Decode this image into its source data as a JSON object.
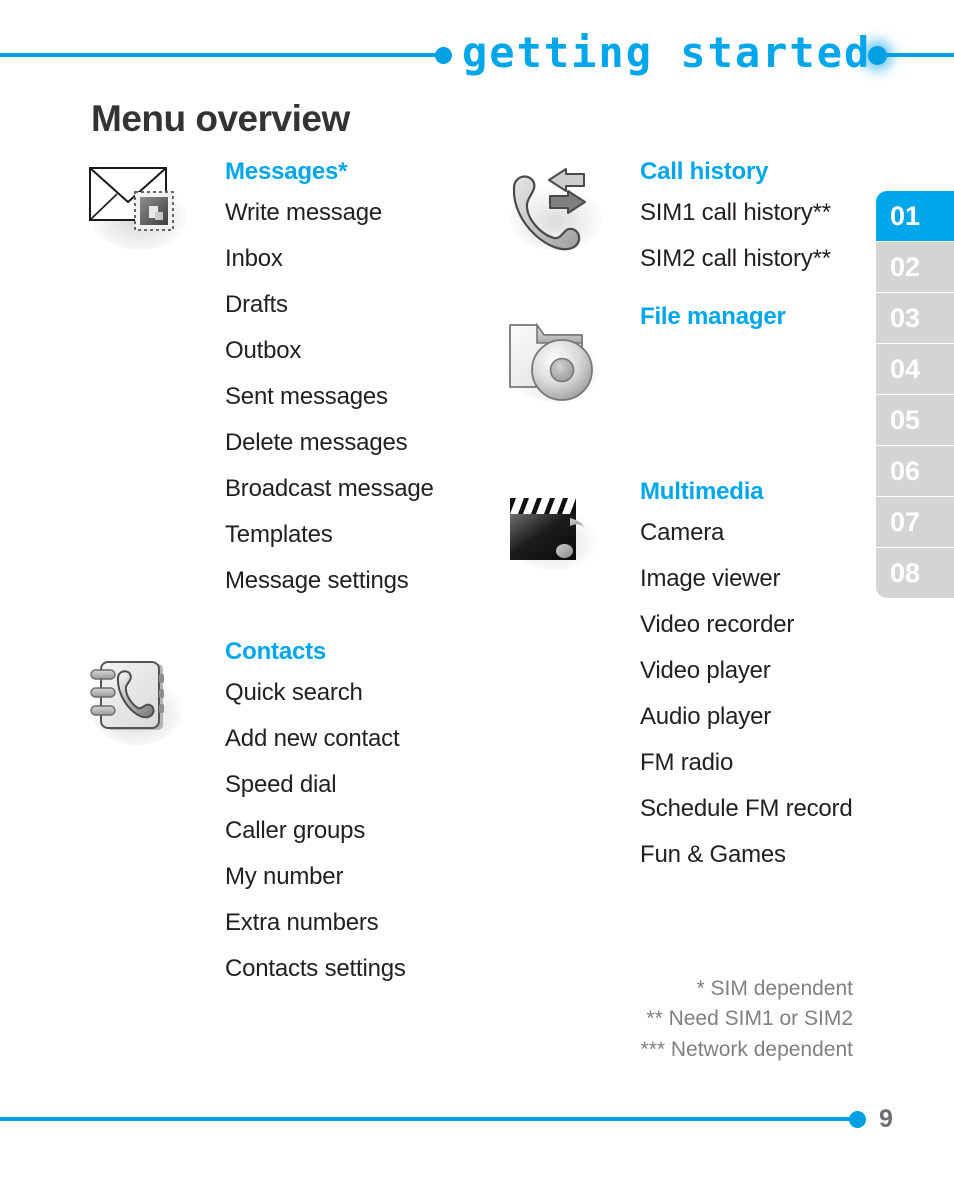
{
  "header": {
    "title": "Getting started",
    "left_dot_icon": "bullet-dot-icon",
    "right_dot_icon": "glow-dot-icon"
  },
  "page_title": "Menu overview",
  "columns": {
    "left": [
      {
        "icon": "envelope-stamp-icon",
        "title": "Messages*",
        "items": [
          "Write message",
          "Inbox",
          "Drafts",
          "Outbox",
          "Sent messages",
          "Delete messages",
          "Broadcast message",
          "Templates",
          "Message settings"
        ]
      },
      {
        "icon": "phonebook-icon",
        "title": "Contacts",
        "items": [
          "Quick search",
          "Add new contact",
          "Speed dial",
          "Caller groups",
          "My number",
          "Extra numbers",
          "Contacts settings"
        ]
      }
    ],
    "right": [
      {
        "icon": "call-history-icon",
        "title": "Call history",
        "items": [
          "SIM1 call history**",
          "SIM2 call history**"
        ]
      },
      {
        "icon": "file-manager-icon",
        "title": "File manager",
        "items": []
      },
      {
        "icon": "multimedia-clapperboard-icon",
        "title": "Multimedia",
        "items": [
          "Camera",
          "Image viewer",
          "Video recorder",
          "Video player",
          "Audio player",
          "FM radio",
          "Schedule FM record",
          "Fun & Games"
        ]
      }
    ]
  },
  "footnotes": [
    "* SIM dependent",
    "** Need SIM1 or SIM2",
    "*** Network dependent"
  ],
  "tabs": {
    "active_index": 0,
    "items": [
      "01",
      "02",
      "03",
      "04",
      "05",
      "06",
      "07",
      "08"
    ]
  },
  "footer": {
    "page_number": "9"
  },
  "colors": {
    "accent": "#00a6ea",
    "rule": "#00a0e3",
    "tab_inactive": "#d4d4d4",
    "body_text": "#231f20",
    "title_text": "#333333",
    "footnote_text": "#808080",
    "page_number_text": "#6d6e71"
  }
}
